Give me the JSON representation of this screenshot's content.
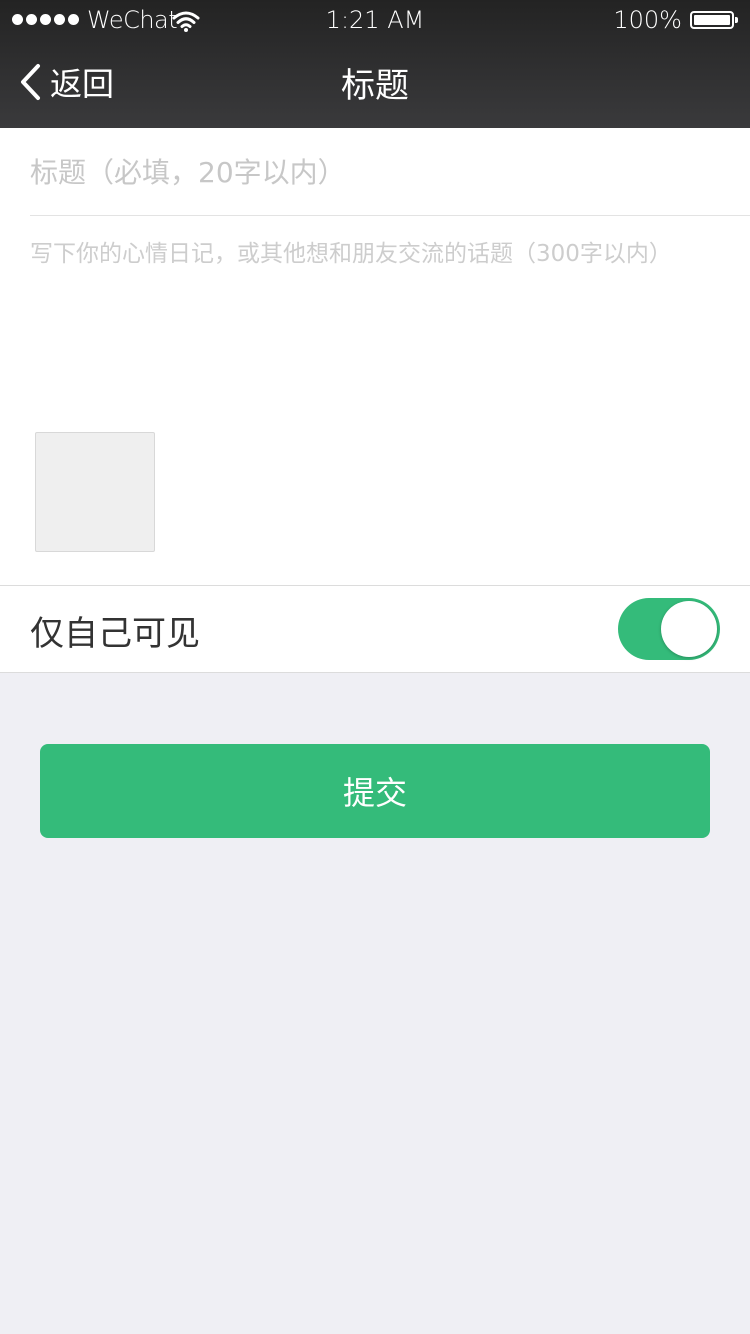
{
  "status_bar": {
    "carrier": "WeChat",
    "time": "1:21 AM",
    "battery": "100%",
    "signal_bars": 5,
    "battery_level": 1.0
  },
  "nav": {
    "back_label": "返回",
    "title": "标题"
  },
  "form": {
    "title_placeholder": "标题（必填，20字以内）",
    "title_value": "",
    "content_placeholder": "写下你的心情日记，或其他想和朋友交流的话题（300字以内）",
    "content_value": ""
  },
  "privacy": {
    "label": "仅自己可见",
    "toggle_on": true
  },
  "submit_label": "提交",
  "colors": {
    "accent": "#34bb7a",
    "background": "#efeff4",
    "nav_bar": "#2c2c2e"
  }
}
